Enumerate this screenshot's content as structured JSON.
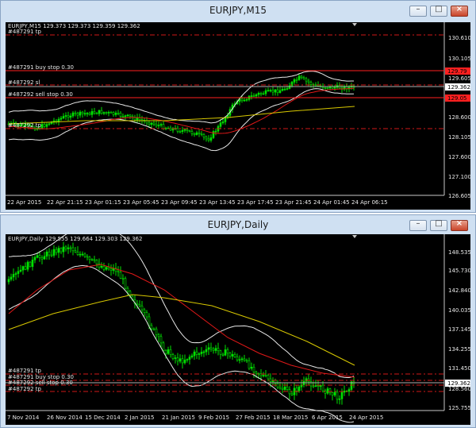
{
  "windows": [
    {
      "title": "EURJPY,M15",
      "buttons": {
        "minimize": "–",
        "maximize": "□",
        "close": "×"
      },
      "symbol_info": "EURJPY,M15  129.373 129.373 129.359 129.362",
      "price_label": "129.362",
      "price_scale": [
        "130.610",
        "130.105",
        "129.605",
        "128.600",
        "128.105",
        "127.600",
        "127.100",
        "126.605"
      ],
      "time_scale": [
        "22 Apr 2015",
        "22 Apr 21:15",
        "23 Apr 01:15",
        "23 Apr 05:45",
        "23 Apr 09:45",
        "23 Apr 13:45",
        "23 Apr 17:45",
        "23 Apr 21:45",
        "24 Apr 01:45",
        "24 Apr 06:15"
      ],
      "orders": [
        {
          "label": "#487291 tp",
          "price": "",
          "color": "#d01818"
        },
        {
          "label": "#487291 buy stop 0.30",
          "price": "129.79",
          "color": "#ff2020"
        },
        {
          "label": "#487292 sl",
          "price": "",
          "color": "#d01818"
        },
        {
          "label": "#487292 sell stop 0.30",
          "price": "129.05",
          "color": "#ff2020"
        },
        {
          "label": "#487292 tp",
          "price": "",
          "color": "#d01818"
        }
      ]
    },
    {
      "title": "EURJPY,Daily",
      "buttons": {
        "minimize": "–",
        "maximize": "□",
        "close": "×"
      },
      "symbol_info": "EURJPY,Daily  129.555 129.664 129.303 129.362",
      "price_label": "129.362",
      "price_scale": [
        "148.535",
        "145.730",
        "142.840",
        "140.035",
        "137.145",
        "134.255",
        "131.450",
        "128.560",
        "125.755"
      ],
      "time_scale": [
        "7 Nov 2014",
        "26 Nov 2014",
        "15 Dec 2014",
        "2 Jan 2015",
        "21 Jan 2015",
        "9 Feb 2015",
        "27 Feb 2015",
        "18 Mar 2015",
        "6 Apr 2015",
        "24 Apr 2015"
      ],
      "orders": [
        {
          "label": "#487291 tp"
        },
        {
          "label": "#487291 buy stop 0.30"
        },
        {
          "label": "#487292 sell stop 0.30"
        },
        {
          "label": "#487292 tp"
        }
      ]
    }
  ],
  "colors": {
    "candle": "#00e000",
    "bands": "#e8e8e8",
    "ma_red": "#e01818",
    "ma_yellow": "#d8c800",
    "grid": "#000000"
  }
}
